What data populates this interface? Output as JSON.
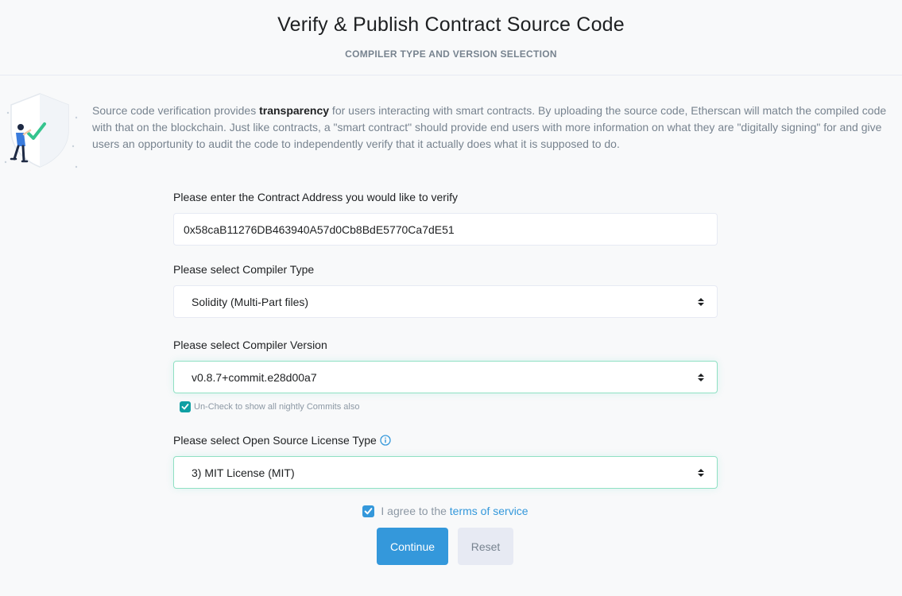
{
  "header": {
    "title": "Verify & Publish Contract Source Code",
    "subtitle": "COMPILER TYPE AND VERSION SELECTION"
  },
  "intro": {
    "before": "Source code verification provides ",
    "bold": "transparency",
    "after": " for users interacting with smart contracts. By uploading the source code, Etherscan will match the compiled code with that on the blockchain. Just like contracts, a \"smart contract\" should provide end users with more information on what they are \"digitally signing\" for and give users an opportunity to audit the code to independently verify that it actually does what it is supposed to do."
  },
  "form": {
    "address_label": "Please enter the Contract Address you would like to verify",
    "address_value": "0x58caB11276DB463940A57d0Cb8BdE5770Ca7dE51",
    "compiler_type_label": "Please select Compiler Type",
    "compiler_type_value": "Solidity (Multi-Part files)",
    "compiler_version_label": "Please select Compiler Version",
    "compiler_version_value": "v0.8.7+commit.e28d00a7",
    "nightly_label": "Un-Check to show all nightly Commits also",
    "license_label": "Please select Open Source License Type",
    "license_value": "3) MIT License (MIT)",
    "agree_text": "I agree to the",
    "terms_link": "terms of service",
    "continue_label": "Continue",
    "reset_label": "Reset"
  },
  "colors": {
    "accent": "#3498db",
    "checkbox": "#0f9fa3",
    "focus_border": "#8fe0c3"
  }
}
